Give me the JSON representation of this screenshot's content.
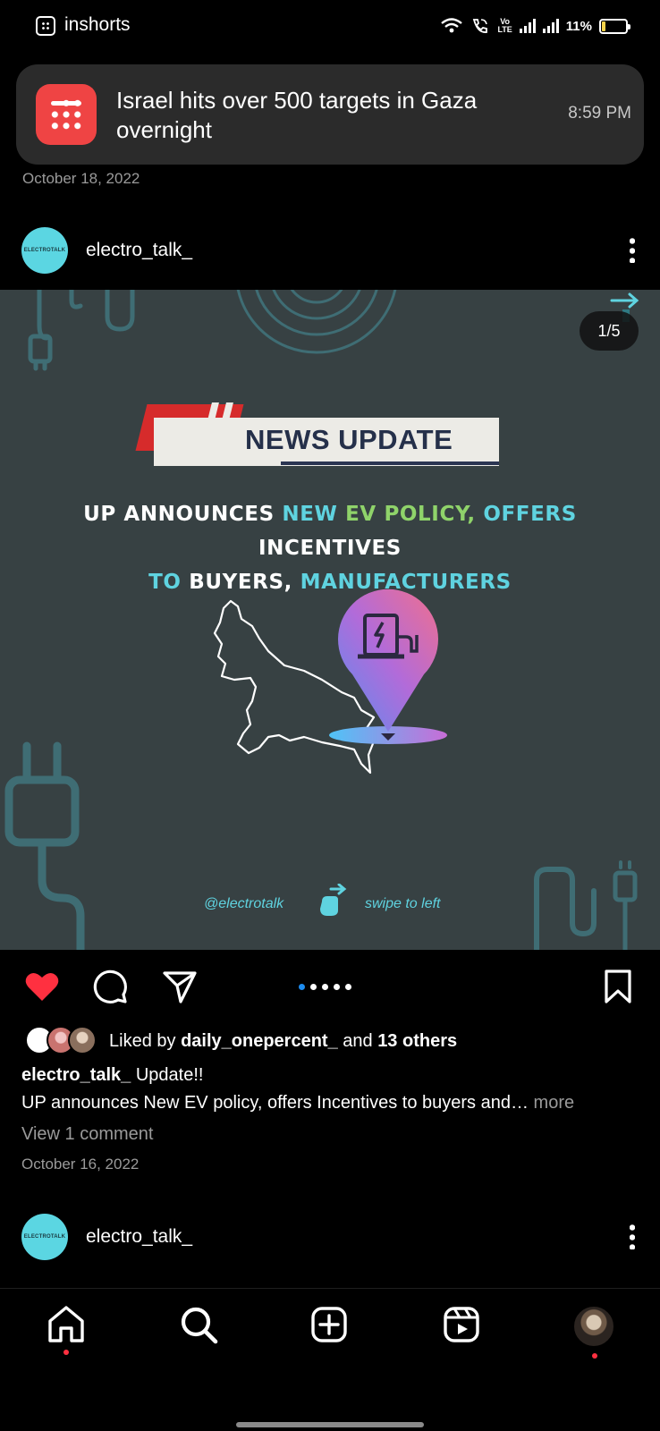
{
  "status_bar": {
    "app_name": "inshorts",
    "battery": "11%",
    "network_tag": "Vo LTE"
  },
  "notification": {
    "title": "Israel hits over 500 targets in Gaza overnight",
    "time": "8:59 PM",
    "date_below": "October 18, 2022"
  },
  "post": {
    "username": "electro_talk_",
    "avatar_text": "ELECTROTALK",
    "counter": "1/5",
    "image": {
      "banner": "NEWS UPDATE",
      "headline_parts": [
        {
          "text": "UP ANNOUNCES ",
          "color": "white"
        },
        {
          "text": "NEW ",
          "color": "cyan"
        },
        {
          "text": "EV POLICY, ",
          "color": "green"
        },
        {
          "text": "OFFERS ",
          "color": "cyan"
        },
        {
          "text": "INCENTIVES",
          "color": "white"
        },
        {
          "text": "TO ",
          "color": "cyan"
        },
        {
          "text": "BUYERS, ",
          "color": "white"
        },
        {
          "text": "MANUFACTURERS",
          "color": "cyan"
        }
      ],
      "footer_handle": "@electrotalk",
      "footer_hint": "swipe to left"
    },
    "carousel": {
      "total": 5,
      "active": 0
    },
    "liked_by_prefix": "Liked by",
    "liked_by_user": "daily_onepercent_",
    "liked_by_and": "and",
    "liked_by_others": "13 others",
    "caption_user": "electro_talk_",
    "caption_line1": "Update!!",
    "caption_line2": "UP announces New EV policy, offers Incentives to buyers and…",
    "caption_more": "more",
    "view_comments": "View 1 comment",
    "date": "October 16, 2022"
  },
  "next_post": {
    "username": "electro_talk_",
    "avatar_text": "ELECTROTALK"
  },
  "colors": {
    "accent_cyan": "#5fd3e0",
    "accent_green": "#8fd36a",
    "like_red": "#ff3040",
    "carousel_active": "#1d8cf0",
    "banner_red": "#d62b2b",
    "image_bg": "#374143"
  },
  "icons": [
    "heart-icon",
    "comment-icon",
    "share-icon",
    "bookmark-icon",
    "home-icon",
    "search-icon",
    "create-icon",
    "reels-icon"
  ]
}
